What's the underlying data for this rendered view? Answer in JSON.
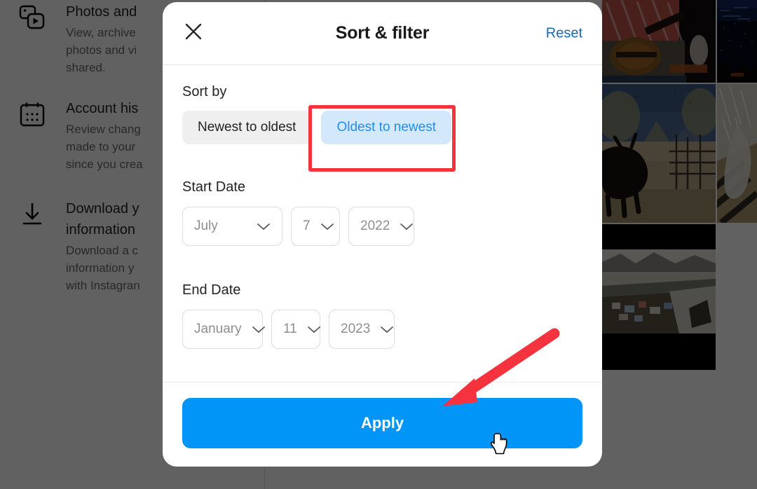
{
  "background": {
    "sections": [
      {
        "icon": "photos-videos-icon",
        "title": "Photos and",
        "desc_lines": [
          "View, archive",
          "photos and vi",
          "shared."
        ]
      },
      {
        "icon": "calendar-icon",
        "title": "Account his",
        "desc_lines": [
          "Review chang",
          "made to your",
          "since you crea"
        ]
      },
      {
        "icon": "download-icon",
        "title_lines": [
          "Download y",
          "information"
        ],
        "desc_lines": [
          "Download a c",
          "information y",
          "with Instagran"
        ]
      }
    ],
    "photos": [
      {
        "name": "photo-guitarist"
      },
      {
        "name": "photo-night-sky"
      },
      {
        "name": "photo-goat-fence"
      },
      {
        "name": "photo-white-animal"
      },
      {
        "name": "photo-snow-scene"
      }
    ]
  },
  "modal": {
    "title": "Sort & filter",
    "close_icon": "close-icon",
    "reset_label": "Reset",
    "sort": {
      "label": "Sort by",
      "options": [
        {
          "label": "Newest to oldest",
          "selected": false
        },
        {
          "label": "Oldest to newest",
          "selected": true
        }
      ]
    },
    "start_date": {
      "label": "Start Date",
      "month": "July",
      "day": "7",
      "year": "2022"
    },
    "end_date": {
      "label": "End Date",
      "month": "January",
      "day": "11",
      "year": "2023"
    },
    "apply_label": "Apply"
  },
  "annotations": {
    "highlight_color": "#f5333f",
    "arrow_color": "#f5333f",
    "cursor": "pointer-hand-cursor"
  },
  "colors": {
    "accent_blue": "#0095f6",
    "link_blue": "#1b69b0",
    "active_pill_bg": "#d3e9fb",
    "active_pill_text": "#1e8ef1",
    "inactive_pill_bg": "#efefef"
  }
}
